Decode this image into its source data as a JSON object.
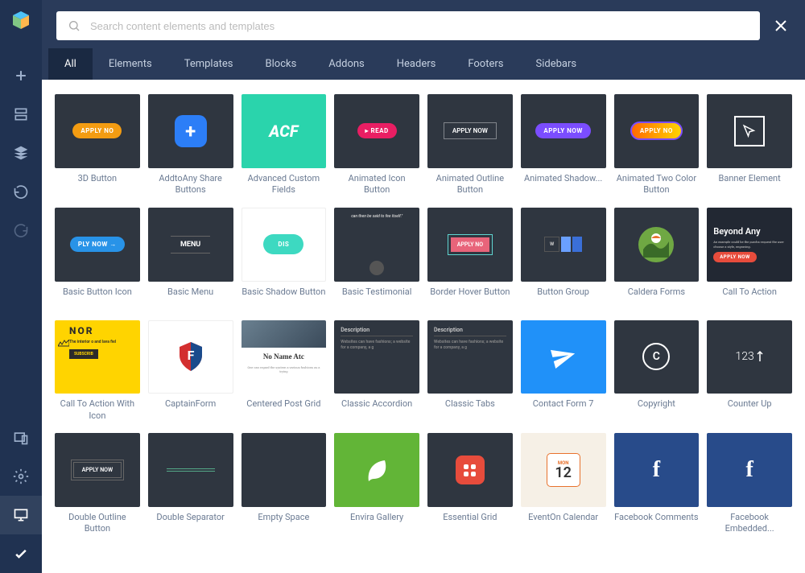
{
  "search": {
    "placeholder": "Search content elements and templates"
  },
  "tabs": [
    "All",
    "Elements",
    "Templates",
    "Blocks",
    "Addons",
    "Headers",
    "Footers",
    "Sidebars"
  ],
  "activeTab": 0,
  "sidebarIcons": [
    "add",
    "panel",
    "layers",
    "undo",
    "redo",
    "devices",
    "settings",
    "desktop",
    "check"
  ],
  "cards": [
    {
      "label": "3D Button"
    },
    {
      "label": "AddtoAny Share Buttons"
    },
    {
      "label": "Advanced Custom Fields"
    },
    {
      "label": "Animated Icon Button"
    },
    {
      "label": "Animated Outline Button"
    },
    {
      "label": "Animated Shadow..."
    },
    {
      "label": "Animated Two Color Button"
    },
    {
      "label": "Banner Element"
    },
    {
      "label": "Basic Button Icon"
    },
    {
      "label": "Basic Menu"
    },
    {
      "label": "Basic Shadow Button"
    },
    {
      "label": "Basic Testimonial"
    },
    {
      "label": "Border Hover Button"
    },
    {
      "label": "Button Group"
    },
    {
      "label": "Caldera Forms"
    },
    {
      "label": "Call To Action"
    },
    {
      "label": "Call To Action With Icon"
    },
    {
      "label": "CaptainForm"
    },
    {
      "label": "Centered Post Grid"
    },
    {
      "label": "Classic Accordion"
    },
    {
      "label": "Classic Tabs"
    },
    {
      "label": "Contact Form 7"
    },
    {
      "label": "Copyright"
    },
    {
      "label": "Counter Up"
    },
    {
      "label": "Double Outline Button"
    },
    {
      "label": "Double Separator"
    },
    {
      "label": "Empty Space"
    },
    {
      "label": "Envira Gallery"
    },
    {
      "label": "Essential Grid"
    },
    {
      "label": "EventOn Calendar"
    },
    {
      "label": "Facebook Comments"
    },
    {
      "label": "Facebook Embedded..."
    }
  ],
  "thumbs": {
    "applyNow": "APPLY NOW",
    "read": "READ",
    "plyNow": "PLY NOW",
    "menu": "MENU",
    "dis": "DIS",
    "quote": "can then be said to fee itself.\"",
    "w": "W",
    "beyond": "Beyond Any",
    "beyondSub": "An example could be the purcha request the user choose a style, engraving.",
    "nor": "NOR",
    "norSub": "The interior o and lava fiel",
    "subscribe": "SUBSCRIB",
    "noName": "No Name Atc",
    "noNameSub": "One can regard the system a various fashions as a trying",
    "description": "Description",
    "descBody": "Websites can have fashions; a website for a company,  a g",
    "counter": "123",
    "mon": "MON",
    "day": "12",
    "acf": "ACF",
    "fb": "f",
    "applyNo": "APPLY NO"
  }
}
